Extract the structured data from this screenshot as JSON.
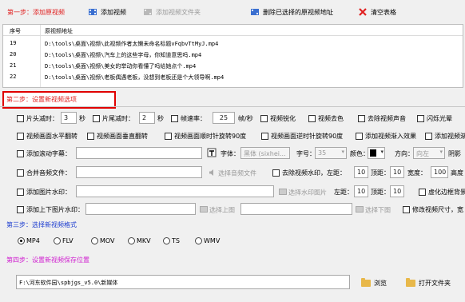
{
  "step1": {
    "label": "第一步：添加原视频",
    "add_video": "添加视频",
    "add_folder": "添加视频文件夹",
    "delete_checked": "删除已选择的原视频地址",
    "clear_table": "清空表格"
  },
  "table": {
    "headers": [
      "序号",
      "原视频地址"
    ],
    "rows": [
      {
        "idx": "19",
        "path": "D:\\tools\\桌面\\视频\\此视频作者太懒未命名标题vFqbvTtMyJ.mp4"
      },
      {
        "idx": "20",
        "path": "D:\\tools\\桌面\\视频\\汽车上的这些字母，你知道意思吗.mp4"
      },
      {
        "idx": "21",
        "path": "D:\\tools\\桌面\\视频\\美女的举动你看懂了吗给她点个.mp4"
      },
      {
        "idx": "22",
        "path": "D:\\tools\\桌面\\视频\\老板偶遇老板，没想到老板还是个大领导啊.mp4"
      }
    ]
  },
  "step2": {
    "label": "第二步：设置新视频选项",
    "row1": {
      "head_cut": "片头减时：",
      "head_val": "3",
      "sec1": "秒",
      "tail_cut": "片尾减时：",
      "tail_val": "2",
      "sec2": "秒",
      "fps": "帧速率：",
      "fps_val": "25",
      "fps_unit": "帧/秒",
      "sharpen": "视频锐化",
      "decolor": "视频去色",
      "remove_audio": "去除视频声音",
      "flash": "闪烁光晕"
    },
    "row2": {
      "hflip": "视频画面水平翻转",
      "vflip": "视频画面垂直翻转",
      "rot_cw": "视频画面顺时针旋转90度",
      "rot_ccw": "视频画面逆时针旋转90度",
      "fade_in": "添加视频渐入效果",
      "fade_out": "添加视频渐"
    },
    "row3": {
      "scroll_subtitle": "添加滚动字幕：",
      "font_label": "字体：",
      "font_val": "黑体 (sixhei...",
      "size_label": "字号：",
      "size_val": "35",
      "color_label": "颜色：",
      "dir_label": "方向：",
      "dir_val": "向左",
      "shadow_label": "阴影"
    },
    "row4": {
      "merge_audio": "合并音频文件：",
      "choose_audio": "选择音频文件",
      "remove_watermark": "去除视频水印，左距：",
      "left_val": "10",
      "top_label": "顶距：",
      "top_val": "10",
      "width_label": "宽度：",
      "width_val": "100",
      "height_label": "高度"
    },
    "row5": {
      "image_watermark": "添加图片水印：",
      "choose_watermark": "选择水印图片",
      "left_label": "左距：",
      "left_val": "10",
      "top_label": "顶距：",
      "top_val": "10",
      "blur_border": "虚化边框背景"
    },
    "row6": {
      "top_bottom": "添加上下图片水印：",
      "choose_top": "选择上图",
      "choose_bottom": "选择下图",
      "resize": "修改视频尺寸，宽"
    }
  },
  "step3": {
    "label": "第三步：选择新视频格式",
    "formats": [
      "MP4",
      "FLV",
      "MOV",
      "MKV",
      "TS",
      "WMV"
    ],
    "selected": "MP4"
  },
  "step4": {
    "label": "第四步：设置新视频保存位置",
    "path": "F:\\河东软件园\\spbjgs_v5.0\\新媒体",
    "browse": "浏览",
    "open_folder": "打开文件夹"
  },
  "colors": {
    "step_red": "#e02020",
    "step_blue": "#2040d0",
    "step_magenta": "#d020d0",
    "highlight_box": "#e00000"
  }
}
